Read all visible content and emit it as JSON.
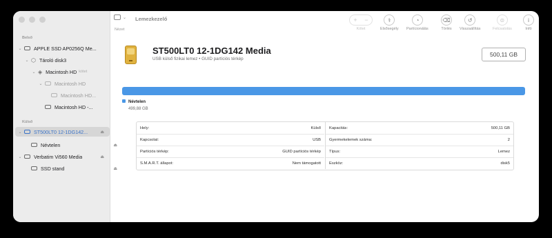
{
  "sidebar": {
    "section_internal": "Belső",
    "section_external": "Külső",
    "items": [
      {
        "label": "APPLE SSD AP0256Q Me..."
      },
      {
        "label": "Tároló disk3"
      },
      {
        "label": "Macintosh HD",
        "tag": "kötet"
      },
      {
        "label": "Macintosh HD"
      },
      {
        "label": "Macintosh HD..."
      },
      {
        "label": "Macintosh HD -..."
      },
      {
        "label": "ST500LT0 12-1DG142..."
      },
      {
        "label": "Névtelen"
      },
      {
        "label": "Verbatim Vi560 Media"
      },
      {
        "label": "SSD stand"
      }
    ]
  },
  "toolbar": {
    "view_label": "Nézet",
    "app_title": "Lemezkezelő",
    "buttons": [
      {
        "label": "Kötet",
        "icon": "plus-minus-icon"
      },
      {
        "label": "Elsősegély",
        "icon": "stethoscope-icon"
      },
      {
        "label": "Partícionálás",
        "icon": "pie-icon"
      },
      {
        "label": "Törlés",
        "icon": "erase-icon"
      },
      {
        "label": "Visszaállítás",
        "icon": "restore-icon"
      },
      {
        "label": "Felcsatolás",
        "icon": "mount-icon"
      },
      {
        "label": "Infó",
        "icon": "info-icon"
      }
    ]
  },
  "disk": {
    "title": "ST500LT0 12-1DG142 Media",
    "subtitle": "USB külső fizikai lemez • GUID partíciós térkép",
    "capacity": "500,11 GB"
  },
  "partition": {
    "name": "Névtelen",
    "size": "499,88 GB",
    "color": "#4a97e6"
  },
  "info": {
    "left": [
      {
        "key": "Hely:",
        "value": "Külső"
      },
      {
        "key": "Kapcsolat:",
        "value": "USB"
      },
      {
        "key": "Partíciós térkép:",
        "value": "GUID partíciós térkép"
      },
      {
        "key": "S.M.A.R.T. állapot:",
        "value": "Nem támogatott"
      }
    ],
    "right": [
      {
        "key": "Kapacitás:",
        "value": "500,11 GB"
      },
      {
        "key": "Gyermekelemek száma:",
        "value": "2"
      },
      {
        "key": "Típus:",
        "value": "Lemez"
      },
      {
        "key": "Eszköz:",
        "value": "disk5"
      }
    ]
  }
}
